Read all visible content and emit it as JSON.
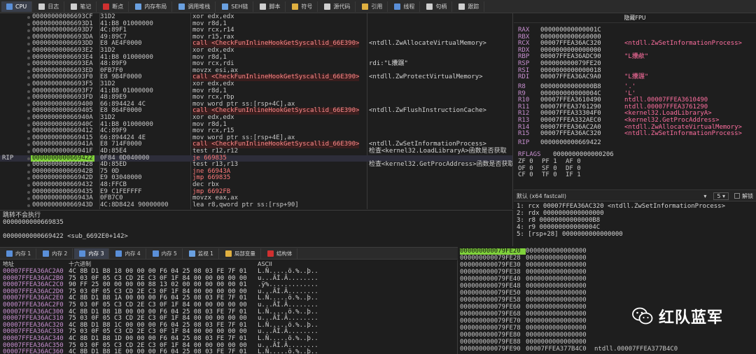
{
  "toolbar": {
    "tabs": [
      {
        "label": "CPU",
        "color": "#5a8fd8"
      },
      {
        "label": "日志",
        "color": "#cfcfcf"
      },
      {
        "label": "笔记",
        "color": "#cfcfcf"
      },
      {
        "label": "断点",
        "color": "#d03030"
      },
      {
        "label": "内存布局",
        "color": "#6aa0e0"
      },
      {
        "label": "调用堆栈",
        "color": "#6aa0e0"
      },
      {
        "label": "SEH链",
        "color": "#6aa0e0"
      },
      {
        "label": "脚本",
        "color": "#cfcfcf"
      },
      {
        "label": "符号",
        "color": "#e0b040"
      },
      {
        "label": "源代码",
        "color": "#cfcfcf"
      },
      {
        "label": "引用",
        "color": "#e0b040"
      },
      {
        "label": "线程",
        "color": "#5a8fd8"
      },
      {
        "label": "句柄",
        "color": "#cfcfcf"
      },
      {
        "label": "跟踪",
        "color": "#cfcfcf"
      }
    ]
  },
  "disasm": {
    "rows": [
      {
        "rip": "",
        "addr": "00000000006693CF",
        "bytes": "31D2",
        "instr": "xor edx,edx",
        "cmt": "",
        "kind": "n"
      },
      {
        "rip": "",
        "addr": "00000000006693D1",
        "bytes": "41:B8 01000000",
        "instr": "mov r8d,1",
        "cmt": "",
        "kind": "n"
      },
      {
        "rip": "",
        "addr": "00000000006693D7",
        "bytes": "4C:89F1",
        "instr": "mov rcx,r14",
        "cmt": "",
        "kind": "n"
      },
      {
        "rip": "",
        "addr": "00000000006693DA",
        "bytes": "49:89C7",
        "instr": "mov r15,rax",
        "cmt": "",
        "kind": "n"
      },
      {
        "rip": "",
        "addr": "00000000006693DD",
        "bytes": "E8 AE4F0000",
        "instr": "call <CheckFunInlineHookGetSyscallid_66E390>",
        "cmt": "<ntdll.ZwAllocateVirtualMemory>",
        "kind": "call"
      },
      {
        "rip": "",
        "addr": "00000000006693E2",
        "bytes": "31D2",
        "instr": "xor edx,edx",
        "cmt": "",
        "kind": "n"
      },
      {
        "rip": "",
        "addr": "00000000006693E4",
        "bytes": "41:B8 01000000",
        "instr": "mov r8d,1",
        "cmt": "",
        "kind": "n"
      },
      {
        "rip": "",
        "addr": "00000000006693EA",
        "bytes": "48:89F9",
        "instr": "mov rcx,rdi",
        "cmt": "rdi:\"L攮蹍\"",
        "kind": "n"
      },
      {
        "rip": "",
        "addr": "00000000006693ED",
        "bytes": "0FB7F0",
        "instr": "movzx esi,ax",
        "cmt": "",
        "kind": "n"
      },
      {
        "rip": "",
        "addr": "00000000006693F0",
        "bytes": "E8 9B4F0000",
        "instr": "call <CheckFunInlineHookGetSyscallid_66E390>",
        "cmt": "<ntdll.ZwProtectVirtualMemory>",
        "kind": "call"
      },
      {
        "rip": "",
        "addr": "00000000006693F5",
        "bytes": "31D2",
        "instr": "xor edx,edx",
        "cmt": "",
        "kind": "n"
      },
      {
        "rip": "",
        "addr": "00000000006693F7",
        "bytes": "41:B8 01000000",
        "instr": "mov r8d,1",
        "cmt": "",
        "kind": "n"
      },
      {
        "rip": "",
        "addr": "00000000006693FD",
        "bytes": "48:89E9",
        "instr": "mov rcx,rbp",
        "cmt": "",
        "kind": "n"
      },
      {
        "rip": "",
        "addr": "0000000000669400",
        "bytes": "66:894424 4C",
        "instr": "mov word ptr ss:[rsp+4C],ax",
        "cmt": "",
        "kind": "n"
      },
      {
        "rip": "",
        "addr": "0000000000669405",
        "bytes": "E8 864F0000",
        "instr": "call <CheckFunInlineHookGetSyscallid_66E390>",
        "cmt": "<ntdll.ZwFlushInstructionCache>",
        "kind": "call"
      },
      {
        "rip": "",
        "addr": "000000000066940A",
        "bytes": "31D2",
        "instr": "xor edx,edx",
        "cmt": "",
        "kind": "n"
      },
      {
        "rip": "",
        "addr": "000000000066940C",
        "bytes": "41:B8 01000000",
        "instr": "mov r8d,1",
        "cmt": "",
        "kind": "n"
      },
      {
        "rip": "",
        "addr": "0000000000669412",
        "bytes": "4C:89F9",
        "instr": "mov rcx,r15",
        "cmt": "",
        "kind": "n"
      },
      {
        "rip": "",
        "addr": "0000000000669415",
        "bytes": "66:894424 4E",
        "instr": "mov word ptr ss:[rsp+4E],ax",
        "cmt": "",
        "kind": "n"
      },
      {
        "rip": "",
        "addr": "000000000066941A",
        "bytes": "E8 714F0000",
        "instr": "call <CheckFunInlineHookGetSyscallid_66E390>",
        "cmt": "<ntdll.ZwSetInformationProcess>",
        "kind": "call"
      },
      {
        "rip": "",
        "addr": "000000000066941F",
        "bytes": "4D:85E4",
        "instr": "test r12,r12",
        "cmt": "检查<kernel32.LoadLibraryA>函数是否获取",
        "kind": "n"
      },
      {
        "rip": "RIP",
        "addr": "0000000000669422",
        "bytes": "0F84 0D040000",
        "instr": "je 669835",
        "cmt": "",
        "kind": "jmp"
      },
      {
        "rip": "",
        "addr": "0000000000669428",
        "bytes": "4D:85ED",
        "instr": "test r13,r13",
        "cmt": "检查<kernel32.GetProcAddress>函数是否获取",
        "kind": "n"
      },
      {
        "rip": "",
        "addr": "000000000066942B",
        "bytes": "75 0D",
        "instr": "jne 66943A",
        "cmt": "",
        "kind": "jmp"
      },
      {
        "rip": "",
        "addr": "000000000066942D",
        "bytes": "E9 03040000",
        "instr": "jmp 669835",
        "cmt": "",
        "kind": "jmp"
      },
      {
        "rip": "",
        "addr": "0000000000669432",
        "bytes": "48:FFCB",
        "instr": "dec rbx",
        "cmt": "",
        "kind": "n"
      },
      {
        "rip": "",
        "addr": "0000000000669435",
        "bytes": "E9 C1FEFFFF",
        "instr": "jmp 6692FB",
        "cmt": "",
        "kind": "jmp"
      },
      {
        "rip": "",
        "addr": "000000000066943A",
        "bytes": "0FB7C0",
        "instr": "movzx eax,ax",
        "cmt": "",
        "kind": "n"
      },
      {
        "rip": "",
        "addr": "000000000066943D",
        "bytes": "4C:8D8424 90000000",
        "instr": "lea r8,qword ptr ss:[rsp+90]",
        "cmt": "",
        "kind": "n"
      }
    ]
  },
  "info": {
    "line1": "跳转不会执行",
    "line2": "0000000000669835",
    "line3": "",
    "line4": "0000000000669422 <sub_6692E0+142>"
  },
  "registers": {
    "title": "隐藏FPU",
    "gp": [
      {
        "n": "RAX",
        "v": "000000000000001C",
        "i": ""
      },
      {
        "n": "RBX",
        "v": "0000000000660000",
        "i": ""
      },
      {
        "n": "RCX",
        "v": "00007FFEA36AC320",
        "i": "<ntdll.ZwSetInformationProcess>"
      },
      {
        "n": "RDX",
        "v": "0000000000000000",
        "i": ""
      },
      {
        "n": "RBP",
        "v": "00007FFEA36ADC90",
        "i": "\"L攮欳\""
      },
      {
        "n": "RSP",
        "v": "000000000079FE20",
        "i": ""
      },
      {
        "n": "RSI",
        "v": "0000000000000018",
        "i": ""
      },
      {
        "n": "RDI",
        "v": "00007FFEA36AC9A0",
        "i": "\"L攮蹍\""
      }
    ],
    "ext": [
      {
        "n": "R8",
        "v": "00000000000000B8",
        "i": "'.'"
      },
      {
        "n": "R9",
        "v": "000000000000004C",
        "i": "'L'"
      },
      {
        "n": "R10",
        "v": "00007FFEA3610490",
        "i": "ntdll.00007FFEA3610490"
      },
      {
        "n": "R11",
        "v": "00007FFEA3761290",
        "i": "ntdll.00007FFEA3761290"
      },
      {
        "n": "R12",
        "v": "00007FFEA33304F0",
        "i": "<kernel32.LoadLibraryA>"
      },
      {
        "n": "R13",
        "v": "00007FFEA332AEC0",
        "i": "<kernel32.GetProcAddress>"
      },
      {
        "n": "R14",
        "v": "00007FFEA36AC2A0",
        "i": "<ntdll.ZwAllocateVirtualMemory>"
      },
      {
        "n": "R15",
        "v": "00007FFEA36AC320",
        "i": "<ntdll.ZwSetInformationProcess>"
      }
    ],
    "rip": {
      "n": "RIP",
      "v": "0000000000669422",
      "i": ""
    },
    "rflags": {
      "n": "RFLAGS",
      "v": "0000000000000206"
    },
    "flags": [
      [
        "ZF 0",
        "PF 1",
        "AF 0"
      ],
      [
        "OF 0",
        "SF 0",
        "DF 0"
      ],
      [
        "CF 0",
        "TF 0",
        "IF 1"
      ]
    ]
  },
  "argbar": {
    "conv": "默认 (x64 fastcall)",
    "count": "5",
    "unlock": "解锁"
  },
  "args": [
    "1: rcx 00007FFEA36AC320 <ntdll.ZwSetInformationProcess>",
    "2: rdx 0000000000000000",
    "3: r8 00000000000000B8",
    "4: r9 000000000000004C",
    "5: [rsp+28] 0000000000000000"
  ],
  "bottom_tabs": [
    "内存 1",
    "内存 2",
    "内存 3",
    "内存 4",
    "内存 5",
    "监视 1",
    "局部变量",
    "结构体"
  ],
  "dump": {
    "h_addr": "地址",
    "h_hex": "十六进制",
    "h_ascii": "ASCII",
    "rows": [
      {
        "a": "00007FFEA36AC2A0",
        "h": "4C 8B D1 B8 18 00 00 00 F6 04 25 08 03 FE 7F 01",
        "x": "L.Ñ.....ö.%..þ.."
      },
      {
        "a": "00007FFEA36AC2B0",
        "h": "75 03 0F 05 C3 CD 2E C3 0F 1F 84 00 00 00 00 00",
        "x": "u...ÃÍ.Ã........"
      },
      {
        "a": "00007FFEA36AC2C0",
        "h": "90 FF 25 00 00 00 00 88 13 02 00 00 00 00 00 01",
        "x": ".ÿ%............."
      },
      {
        "a": "00007FFEA36AC2D0",
        "h": "75 03 0F 05 C3 CD 2E C3 0F 1F 84 00 00 00 00 00",
        "x": "u...ÃÍ.Ã........"
      },
      {
        "a": "00007FFEA36AC2E0",
        "h": "4C 8B D1 B8 1A 00 00 00 F6 04 25 08 03 FE 7F 01",
        "x": "L.Ñ.....ö.%..þ.."
      },
      {
        "a": "00007FFEA36AC2F0",
        "h": "75 03 0F 05 C3 CD 2E C3 0F 1F 84 00 00 00 00 00",
        "x": "u...ÃÍ.Ã........"
      },
      {
        "a": "00007FFEA36AC300",
        "h": "4C 8B D1 B8 1B 00 00 00 F6 04 25 08 03 FE 7F 01",
        "x": "L.Ñ.....ö.%..þ.."
      },
      {
        "a": "00007FFEA36AC310",
        "h": "75 03 0F 05 C3 CD 2E C3 0F 1F 84 00 00 00 00 00",
        "x": "u...ÃÍ.Ã........"
      },
      {
        "a": "00007FFEA36AC320",
        "h": "4C 8B D1 B8 1C 00 00 00 F6 04 25 08 03 FE 7F 01",
        "x": "L.Ñ.....ö.%..þ.."
      },
      {
        "a": "00007FFEA36AC330",
        "h": "75 03 0F 05 C3 CD 2E C3 0F 1F 84 00 00 00 00 00",
        "x": "u...ÃÍ.Ã........"
      },
      {
        "a": "00007FFEA36AC340",
        "h": "4C 8B D1 B8 1D 00 00 00 F6 04 25 08 03 FE 7F 01",
        "x": "L.Ñ.....ö.%..þ.."
      },
      {
        "a": "00007FFEA36AC350",
        "h": "75 03 0F 05 C3 CD 2E C3 0F 1F 84 00 00 00 00 00",
        "x": "u...ÃÍ.Ã........"
      },
      {
        "a": "00007FFEA36AC360",
        "h": "4C 8B D1 B8 1E 00 00 00 F6 04 25 08 03 FE 7F 01",
        "x": "L.Ñ.....ö.%..þ.."
      }
    ]
  },
  "stack": {
    "rows": [
      {
        "a": "000000000079FE20",
        "v": "0000000000000000",
        "c": ""
      },
      {
        "a": "000000000079FE28",
        "v": "0000000000000000",
        "c": ""
      },
      {
        "a": "000000000079FE30",
        "v": "0000000000000000",
        "c": ""
      },
      {
        "a": "000000000079FE38",
        "v": "0000000000000000",
        "c": ""
      },
      {
        "a": "000000000079FE40",
        "v": "0000000000000000",
        "c": ""
      },
      {
        "a": "000000000079FE48",
        "v": "0000000000000000",
        "c": ""
      },
      {
        "a": "000000000079FE50",
        "v": "0000000000000000",
        "c": ""
      },
      {
        "a": "000000000079FE58",
        "v": "0000000000000000",
        "c": ""
      },
      {
        "a": "000000000079FE60",
        "v": "0000000000000000",
        "c": ""
      },
      {
        "a": "000000000079FE68",
        "v": "0000000000000000",
        "c": ""
      },
      {
        "a": "000000000079FE70",
        "v": "0000000000000000",
        "c": ""
      },
      {
        "a": "000000000079FE78",
        "v": "0000000000000000",
        "c": ""
      },
      {
        "a": "000000000079FE80",
        "v": "0000000000000000",
        "c": ""
      },
      {
        "a": "000000000079FE88",
        "v": "0000000000000000",
        "c": ""
      },
      {
        "a": "000000000079FE90",
        "v": "00007FFEA377B4C0",
        "c": "ntdll.00007FFEA377B4C0"
      }
    ]
  },
  "watermark": {
    "text": "红队蓝军"
  }
}
